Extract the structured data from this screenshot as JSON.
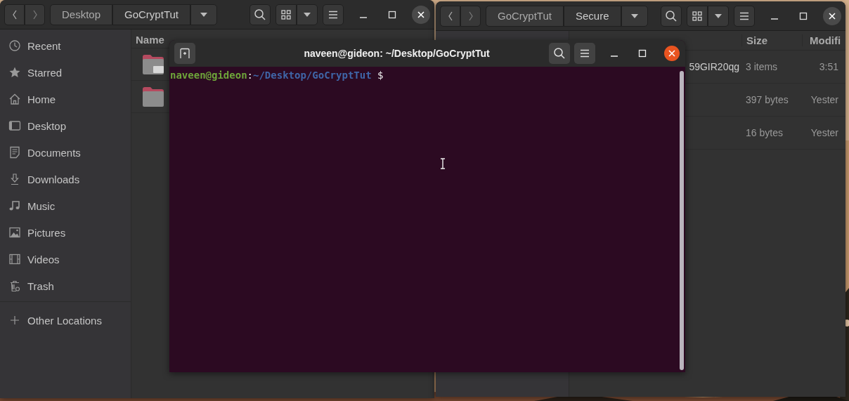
{
  "left_window": {
    "path": [
      {
        "label": "Desktop",
        "selected": false
      },
      {
        "label": "GoCryptTut",
        "selected": true
      }
    ],
    "sidebar": [
      {
        "label": "Recent"
      },
      {
        "label": "Starred"
      },
      {
        "label": "Home"
      },
      {
        "label": "Desktop"
      },
      {
        "label": "Documents"
      },
      {
        "label": "Downloads"
      },
      {
        "label": "Music"
      },
      {
        "label": "Pictures"
      },
      {
        "label": "Videos"
      },
      {
        "label": "Trash"
      }
    ],
    "other_locations": "Other Locations",
    "columns": [
      "Name"
    ],
    "rows": [
      {
        "kind": "drive-folder"
      },
      {
        "kind": "folder"
      }
    ]
  },
  "right_window": {
    "path": [
      {
        "label": "GoCryptTut",
        "selected": false
      },
      {
        "label": "Secure",
        "selected": true
      }
    ],
    "columns": [
      "Size",
      "Modifi"
    ],
    "rows": [
      {
        "name": "59GIR20qg",
        "size": "3 items",
        "modified": "3:51"
      },
      {
        "size": "397 bytes",
        "modified": "Yester"
      },
      {
        "size": "16 bytes",
        "modified": "Yester"
      }
    ]
  },
  "terminal": {
    "title": "naveen@gideon: ~/Desktop/GoCryptTut",
    "prompt": {
      "user": "naveen@gideon",
      "separator": ":",
      "path": "~/Desktop/GoCryptTut",
      "symbol": "$"
    }
  }
}
